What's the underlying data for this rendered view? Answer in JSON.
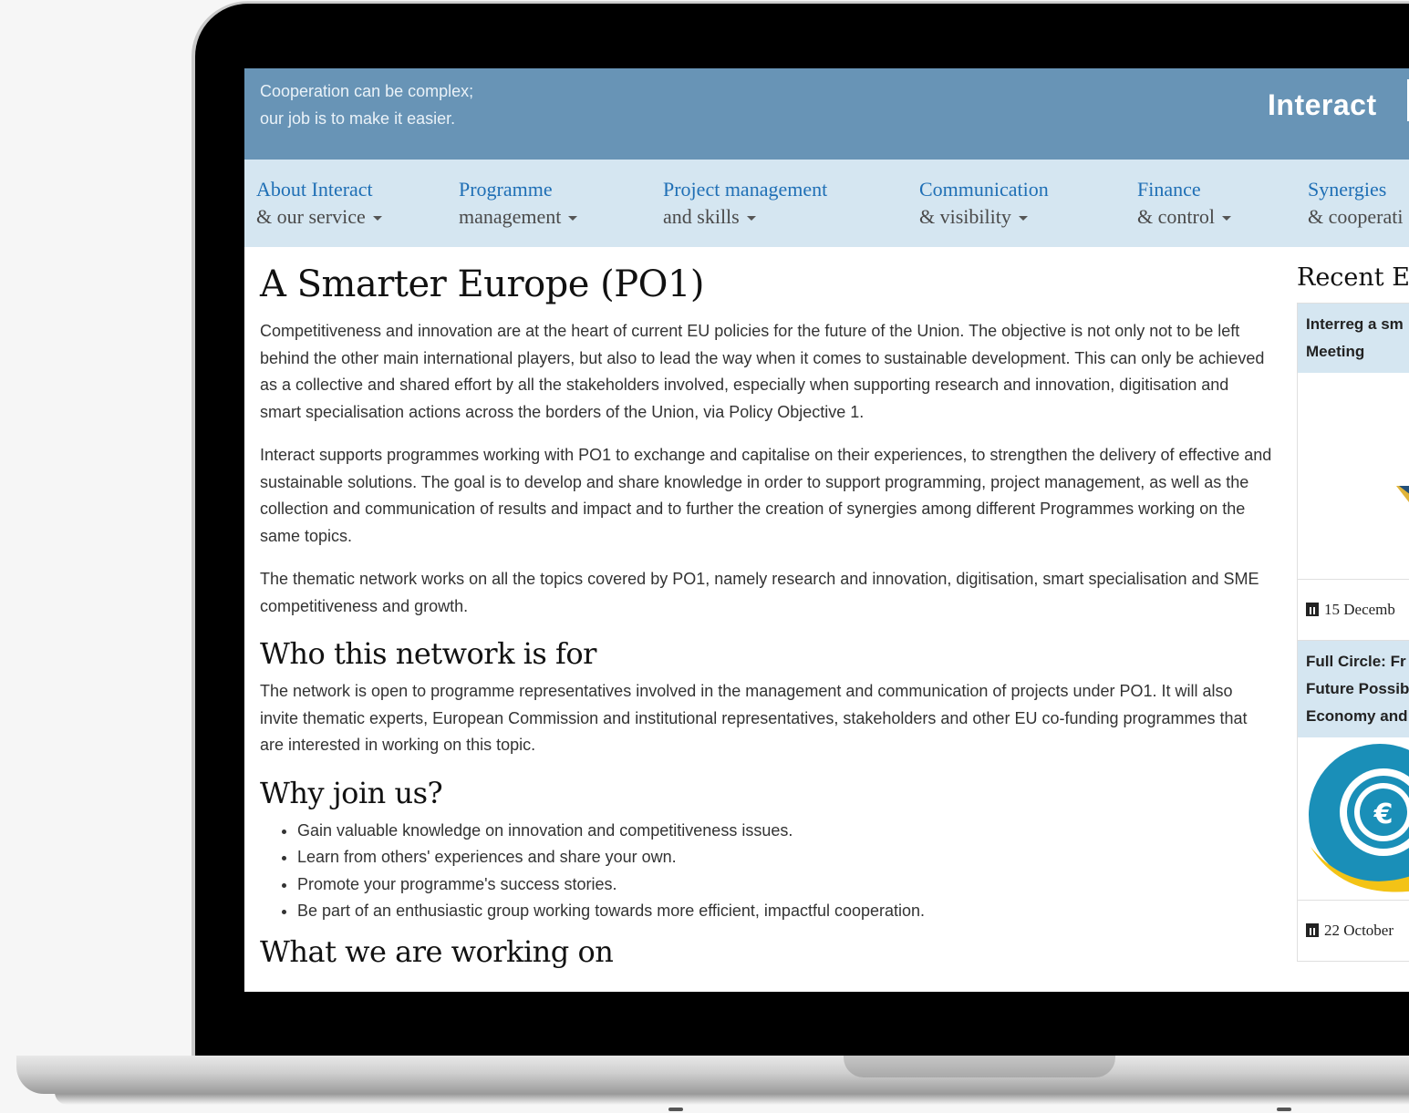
{
  "header": {
    "tagline_line1": "Cooperation can be complex;",
    "tagline_line2": "our job is to make it easier.",
    "brand": "Interact"
  },
  "nav": {
    "items": [
      {
        "line1": "About Interact",
        "line2": "& our service"
      },
      {
        "line1": "Programme",
        "line2": "management"
      },
      {
        "line1": "Project management",
        "line2": "and skills"
      },
      {
        "line1": "Communication",
        "line2": "& visibility"
      },
      {
        "line1": "Finance",
        "line2": "& control"
      },
      {
        "line1": "Synergies",
        "line2": "& cooperati"
      }
    ]
  },
  "main": {
    "title": "A Smarter Europe (PO1)",
    "paragraphs": [
      "Competitiveness and innovation are at the heart of current EU policies for the future of the Union. The objective is not only not to be left behind the other main international players, but also to lead the way when it comes to sustainable development. This can only be achieved as a collective and shared effort by all the stakeholders involved, especially when supporting research and innovation, digitisation and smart specialisation actions across the borders of the Union, via Policy Objective 1.",
      "Interact supports programmes working with PO1 to exchange and capitalise on their experiences, to strengthen the delivery of effective and sustainable solutions. The goal is to develop and share knowledge in order to support programming, project management, as well as the collection and communication of results and impact and to further the creation of synergies among different Programmes working on the same topics.",
      "The thematic network works on all the topics covered by PO1, namely research and innovation, digitisation, smart specialisation and SME competitiveness and growth."
    ],
    "who_heading": "Who this network is for",
    "who_text": "The network is open to programme representatives involved in the management and communication of projects under PO1. It will also invite thematic experts, European Commission and institutional representatives, stakeholders and other EU co-funding programmes that are interested in working on this topic.",
    "why_heading": "Why join us?",
    "why_items": [
      "Gain valuable knowledge on innovation and competitiveness issues.",
      "Learn from others' experiences and share your own.",
      "Promote your programme's success stories.",
      "Be part of an enthusiastic group working towards more efficient, impactful cooperation."
    ],
    "working_heading": "What we are working on"
  },
  "sidebar": {
    "title": "Recent E",
    "events": [
      {
        "line1": "Interreg a sm",
        "line2": "Meeting",
        "date": "15 Decemb"
      },
      {
        "line1": "Full Circle: Fr",
        "line2": "Future Possib",
        "line3": "Economy and",
        "date": "22 October"
      }
    ]
  },
  "colors": {
    "header_bg": "#6894b6",
    "nav_bg": "#d5e6f1",
    "nav_link": "#1f6fb5",
    "event_logo_blue": "#1a8fb8",
    "event_logo_yellow": "#f3c316"
  }
}
